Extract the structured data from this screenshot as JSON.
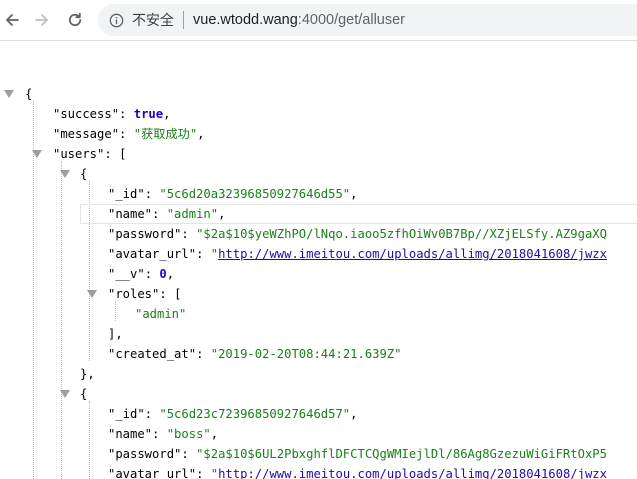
{
  "browser": {
    "security_label": "不安全",
    "url_host": "vue.wtodd.wang",
    "url_rest": ":4000/get/alluser"
  },
  "json": {
    "open_brace": "{",
    "success_key": "\"success\"",
    "success_value": "true",
    "message_key": "\"message\"",
    "message_value": "\"获取成功\"",
    "users_key": "\"users\"",
    "users_open": "[",
    "users": [
      {
        "id_key": "\"_id\"",
        "id_value": "\"5c6d20a32396850927646d55\"",
        "name_key": "\"name\"",
        "name_value": "\"admin\"",
        "password_key": "\"password\"",
        "password_value": "\"$2a$10$yeWZhPO/lNqo.iaoo5zfhOiWv0B7Bp//XZjELSfy.AZ9gaXQ",
        "avatar_key": "\"avatar_url\"",
        "avatar_value": "\"http://www.imeitou.com/uploads/allimg/2018041608/jwzx",
        "v_key": "\"__v\"",
        "v_value": "0",
        "roles_key": "\"roles\"",
        "roles_open": "[",
        "roles": [
          "\"admin\""
        ],
        "roles_close": "],",
        "created_key": "\"created_at\"",
        "created_value": "\"2019-02-20T08:44:21.639Z\""
      },
      {
        "id_key": "\"_id\"",
        "id_value": "\"5c6d23c72396850927646d57\"",
        "name_key": "\"name\"",
        "name_value": "\"boss\"",
        "password_key": "\"password\"",
        "password_value": "\"$2a$10$6UL2PbxghflDFCTCQgWMIejlDl/86Ag8GzezuWiGiFRtOxP5",
        "avatar_key": "\"avatar_url\"",
        "avatar_value": "\"http://www.imeitou.com/uploads/allimg/2018041608/jwzx"
      }
    ],
    "obj_open": "{",
    "obj_close": "},"
  },
  "icons": {
    "back": "arrow-left-icon",
    "forward": "arrow-right-icon",
    "reload": "reload-icon",
    "info": "info-icon",
    "toggle": "triangle-down-icon"
  },
  "colors": {
    "key": "#881391",
    "string": "#1a7f1a",
    "literal": "#1c00cf",
    "link": "#1a0dab"
  }
}
